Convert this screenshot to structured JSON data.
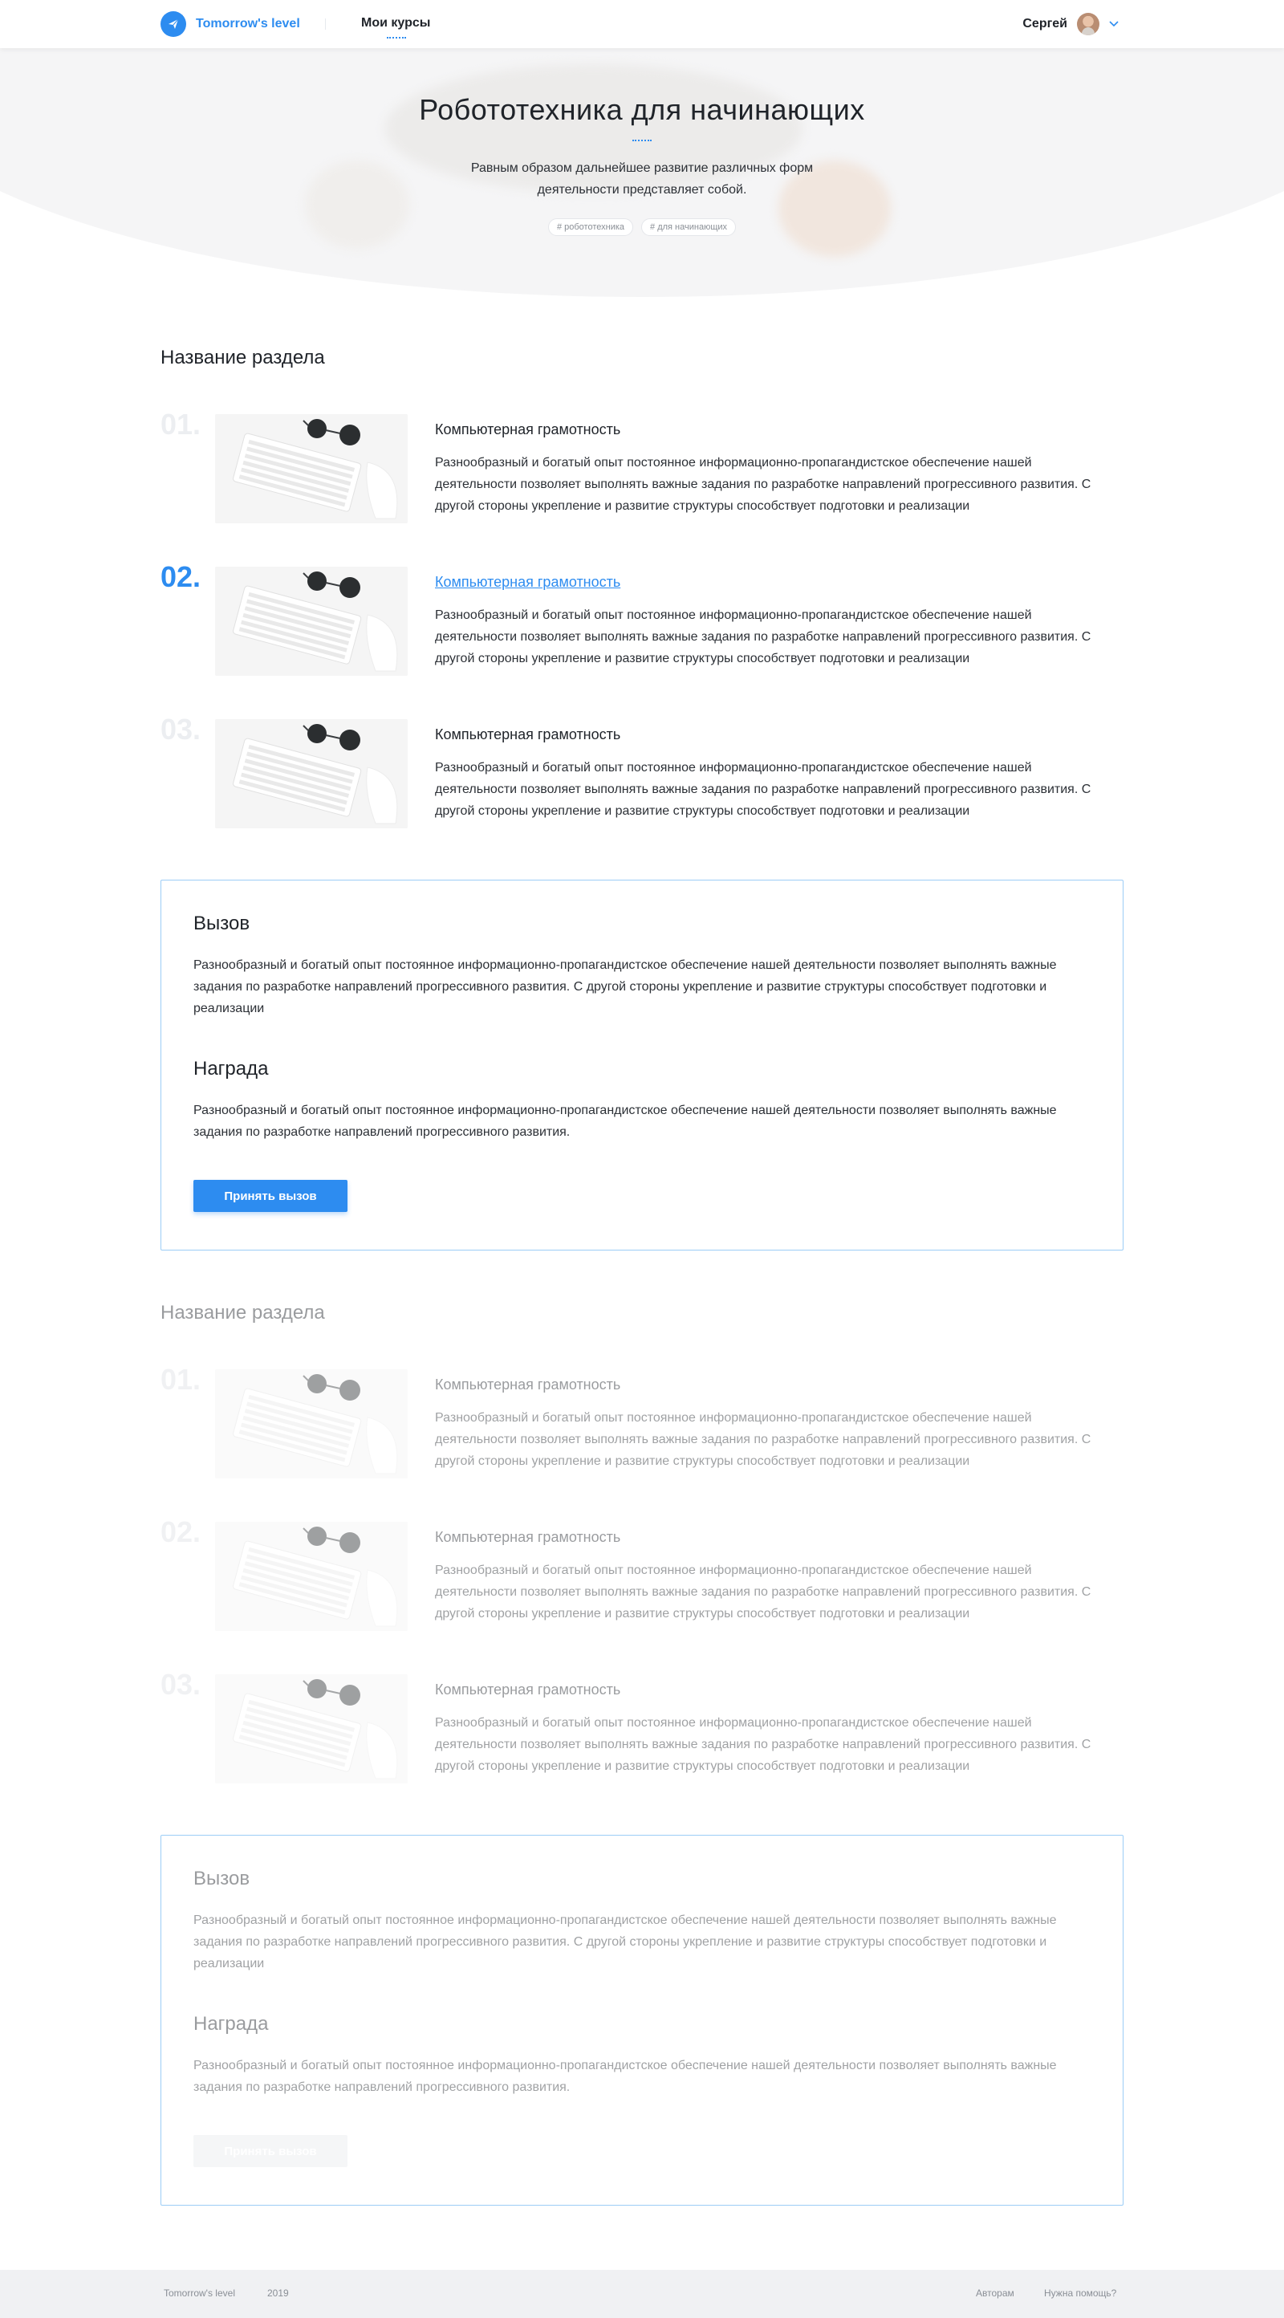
{
  "header": {
    "brand": "Tomorrow's level",
    "nav_item": "Мои курсы",
    "user_name": "Сергей"
  },
  "hero": {
    "title": "Робототехника для начинающих",
    "description": "Равным образом дальнейшее развитие различных форм деятельности представляет собой.",
    "tags": [
      "# робототехника",
      "# для начинающих"
    ]
  },
  "sections": [
    {
      "title": "Название раздела",
      "lessons": [
        {
          "number": "01.",
          "title": "Компьютерная грамотность",
          "text": "Разнообразный и богатый опыт постоянное информационно-пропагандистское обеспечение нашей деятельности позволяет выполнять важные задания по разработке направлений прогрессивного развития. С другой стороны укрепление и развитие структуры способствует подготовки и реализации"
        },
        {
          "number": "02.",
          "title": "Компьютерная грамотность",
          "text": "Разнообразный и богатый опыт постоянное информационно-пропагандистское обеспечение нашей деятельности позволяет выполнять важные задания по разработке направлений прогрессивного развития. С другой стороны укрепление и развитие структуры способствует подготовки и реализации"
        },
        {
          "number": "03.",
          "title": "Компьютерная грамотность",
          "text": "Разнообразный и богатый опыт постоянное информационно-пропагандистское обеспечение нашей деятельности позволяет выполнять важные задания по разработке направлений прогрессивного развития. С другой стороны укрепление и развитие структуры способствует подготовки и реализации"
        }
      ],
      "challenge": {
        "challenge_title": "Вызов",
        "challenge_text": "Разнообразный и богатый опыт постоянное информационно-пропагандистское обеспечение нашей деятельности позволяет выполнять важные задания по разработке направлений прогрессивного развития. С другой стороны укрепление и развитие структуры способствует подготовки и реализации",
        "reward_title": "Награда",
        "reward_text": "Разнообразный и богатый опыт постоянное информационно-пропагандистское обеспечение нашей деятельности позволяет выполнять важные задания по разработке направлений прогрессивного развития.",
        "button": "Принять вызов"
      }
    },
    {
      "title": "Название раздела",
      "lessons": [
        {
          "number": "01.",
          "title": "Компьютерная грамотность",
          "text": "Разнообразный и богатый опыт постоянное информационно-пропагандистское обеспечение нашей деятельности позволяет выполнять важные задания по разработке направлений прогрессивного развития. С другой стороны укрепление и развитие структуры способствует подготовки и реализации"
        },
        {
          "number": "02.",
          "title": "Компьютерная грамотность",
          "text": "Разнообразный и богатый опыт постоянное информационно-пропагандистское обеспечение нашей деятельности позволяет выполнять важные задания по разработке направлений прогрессивного развития. С другой стороны укрепление и развитие структуры способствует подготовки и реализации"
        },
        {
          "number": "03.",
          "title": "Компьютерная грамотность",
          "text": "Разнообразный и богатый опыт постоянное информационно-пропагандистское обеспечение нашей деятельности позволяет выполнять важные задания по разработке направлений прогрессивного развития. С другой стороны укрепление и развитие структуры способствует подготовки и реализации"
        }
      ],
      "challenge": {
        "challenge_title": "Вызов",
        "challenge_text": "Разнообразный и богатый опыт постоянное информационно-пропагандистское обеспечение нашей деятельности позволяет выполнять важные задания по разработке направлений прогрессивного развития. С другой стороны укрепление и развитие структуры способствует подготовки и реализации",
        "reward_title": "Награда",
        "reward_text": "Разнообразный и богатый опыт постоянное информационно-пропагандистское обеспечение нашей деятельности позволяет выполнять важные задания по разработке направлений прогрессивного развития.",
        "button": "Принять вызов"
      }
    }
  ],
  "footer": {
    "brand": "Tomorrow's level",
    "year": "2019",
    "authors_link": "Авторам",
    "help_link": "Нужна помощь?"
  },
  "colors": {
    "accent": "#2d8cf0",
    "challenge_border": "#9ccdf6",
    "footer_bg": "#f0f1f3"
  }
}
